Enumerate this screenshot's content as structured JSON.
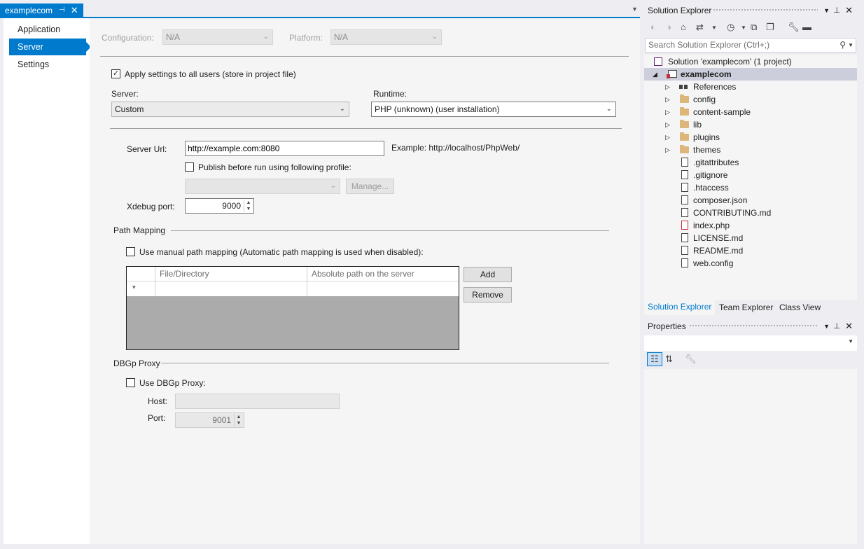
{
  "document_tab": {
    "title": "examplecom",
    "pin_icon": "⊣",
    "close_icon": "✕",
    "dropdown_icon": "▼"
  },
  "nav": {
    "items": [
      {
        "label": "Application"
      },
      {
        "label": "Server"
      },
      {
        "label": "Settings"
      }
    ],
    "selected": "Server"
  },
  "form": {
    "configuration_label": "Configuration:",
    "configuration_value": "N/A",
    "platform_label": "Platform:",
    "platform_value": "N/A",
    "apply_all_users_label": "Apply settings to all users (store in project file)",
    "apply_all_users_checked": true,
    "server_label": "Server:",
    "server_value": "Custom",
    "runtime_label": "Runtime:",
    "runtime_value": "PHP (unknown) (user installation)",
    "server_url_label": "Server Url:",
    "server_url_value": "http://example.com:8080",
    "server_url_example": "Example: http://localhost/PhpWeb/",
    "publish_label": "Publish before run using following profile:",
    "publish_checked": false,
    "manage_label": "Manage...",
    "xdebug_port_label": "Xdebug port:",
    "xdebug_port_value": "9000",
    "path_mapping_header": "Path Mapping",
    "manual_mapping_label": "Use manual path mapping (Automatic path mapping is used when disabled):",
    "manual_mapping_checked": false,
    "grid_columns": [
      "File/Directory",
      "Absolute path on the server"
    ],
    "grid_new_row_marker": "*",
    "add_label": "Add",
    "remove_label": "Remove",
    "dbgp_header": "DBGp Proxy",
    "use_dbgp_label": "Use DBGp Proxy:",
    "use_dbgp_checked": false,
    "host_label": "Host:",
    "host_value": "",
    "port_label": "Port:",
    "port_value": "9001",
    "check_mark": "✓",
    "dropdown_arrow": "⌄",
    "spin_arrows": "▲▼"
  },
  "solution_explorer": {
    "title": "Solution Explorer",
    "search_placeholder": "Search Solution Explorer (Ctrl+;)",
    "toolbar_icons": [
      "back-icon",
      "forward-icon",
      "home-icon",
      "sync-icon",
      "history-icon",
      "collapse-all-icon",
      "show-all-files-icon",
      "properties-wrench-icon",
      "minus-icon"
    ],
    "tree": [
      {
        "label": "Solution 'examplecom' (1 project)",
        "type": "solution",
        "level": 0
      },
      {
        "label": "examplecom",
        "type": "project",
        "level": 1,
        "expanded": true,
        "selected": true
      },
      {
        "label": "References",
        "type": "references",
        "level": 2,
        "expandable": true
      },
      {
        "label": "config",
        "type": "folder",
        "level": 2,
        "expandable": true
      },
      {
        "label": "content-sample",
        "type": "folder",
        "level": 2,
        "expandable": true
      },
      {
        "label": "lib",
        "type": "folder",
        "level": 2,
        "expandable": true
      },
      {
        "label": "plugins",
        "type": "folder",
        "level": 2,
        "expandable": true
      },
      {
        "label": "themes",
        "type": "folder",
        "level": 2,
        "expandable": true
      },
      {
        "label": ".gitattributes",
        "type": "file",
        "level": 2
      },
      {
        "label": ".gitignore",
        "type": "file",
        "level": 2
      },
      {
        "label": ".htaccess",
        "type": "file",
        "level": 2
      },
      {
        "label": "composer.json",
        "type": "file",
        "level": 2
      },
      {
        "label": "CONTRIBUTING.md",
        "type": "file",
        "level": 2
      },
      {
        "label": "index.php",
        "type": "file",
        "level": 2
      },
      {
        "label": "LICENSE.md",
        "type": "file",
        "level": 2
      },
      {
        "label": "README.md",
        "type": "file",
        "level": 2
      },
      {
        "label": "web.config",
        "type": "file",
        "level": 2
      }
    ],
    "tabs": [
      "Solution Explorer",
      "Team Explorer",
      "Class View"
    ],
    "active_tab": "Solution Explorer"
  },
  "properties": {
    "title": "Properties"
  },
  "colors": {
    "accent": "#007acc",
    "selection": "#cccedb",
    "folder": "#dcb67a"
  }
}
